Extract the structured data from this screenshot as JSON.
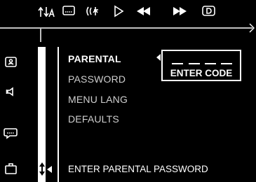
{
  "top_bar": {
    "icons": [
      "audio-language-icon",
      "subtitle-icon",
      "angle-icon",
      "play-icon",
      "rewind-icon",
      "fast-forward-icon",
      "dolby-digital-icon"
    ]
  },
  "sidebar": {
    "icons": [
      "parental-lock-icon",
      "speaker-icon",
      "subtitle-bubble-icon",
      "briefcase-icon"
    ]
  },
  "menu": {
    "items": [
      {
        "label": "PARENTAL",
        "selected": true
      },
      {
        "label": "PASSWORD",
        "selected": false
      },
      {
        "label": "MENU LANG",
        "selected": false
      },
      {
        "label": "DEFAULTS",
        "selected": false
      }
    ]
  },
  "code_entry": {
    "label": "ENTER CODE",
    "slots": 4
  },
  "status": {
    "text": "ENTER PARENTAL PASSWORD"
  }
}
